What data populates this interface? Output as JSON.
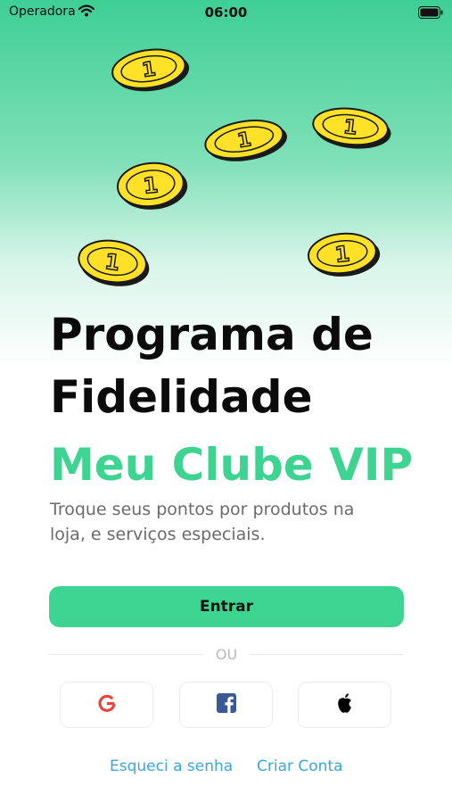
{
  "status_bar": {
    "carrier": "Operadora",
    "time": "06:00"
  },
  "hero": {
    "title": "Programa de Fidelidade",
    "brand": "Meu Clube VIP",
    "description": "Troque seus pontos por produtos na loja, e serviços especiais."
  },
  "actions": {
    "primary_label": "Entrar",
    "divider_text": "OU",
    "social": [
      {
        "name": "Google",
        "icon": "google-icon"
      },
      {
        "name": "Facebook",
        "icon": "facebook-icon"
      },
      {
        "name": "Apple",
        "icon": "apple-icon"
      }
    ]
  },
  "links": {
    "forgot_password": "Esqueci a senha",
    "create_account": "Criar Conta"
  },
  "colors": {
    "accent": "#3dd391",
    "link": "#39a6df",
    "coin": "#ffe227"
  }
}
